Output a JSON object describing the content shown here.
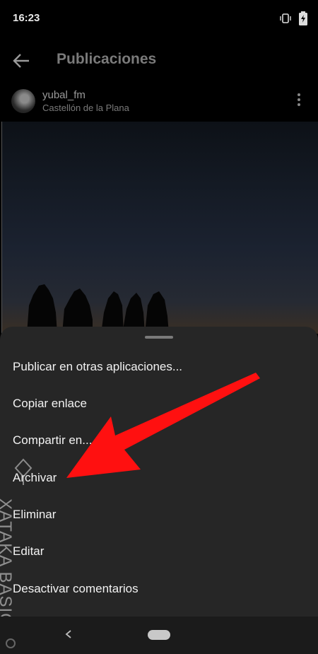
{
  "status_bar": {
    "time": "16:23"
  },
  "app_bar": {
    "title": "Publicaciones"
  },
  "post": {
    "username": "yubal_fm",
    "location": "Castellón de la Plana"
  },
  "menu": {
    "items": [
      "Publicar en otras aplicaciones...",
      "Copiar enlace",
      "Compartir en...",
      "Archivar",
      "Eliminar",
      "Editar",
      "Desactivar comentarios"
    ]
  },
  "watermark": {
    "text": "XATAKA BASICS"
  },
  "colors": {
    "arrow": "#ff1010",
    "sheet": "#262626",
    "background": "#000000"
  },
  "icons": [
    "vibrate-icon",
    "battery-icon",
    "back-arrow-icon",
    "more-vert-icon",
    "nav-back-icon",
    "nav-home-pill"
  ]
}
